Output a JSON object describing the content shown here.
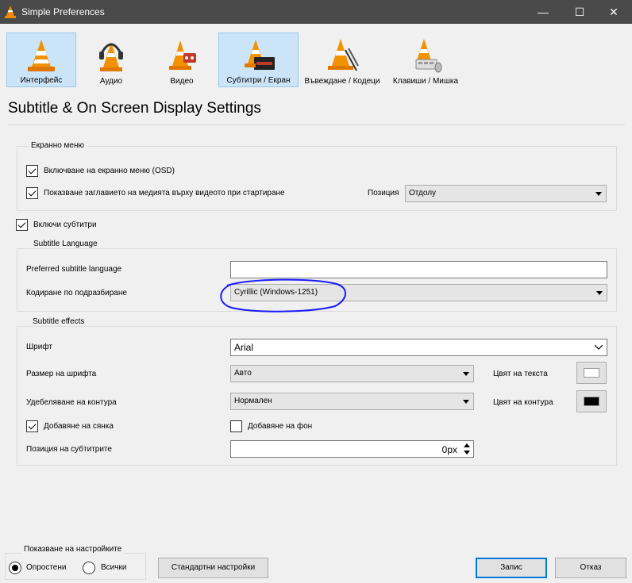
{
  "window": {
    "title": "Simple Preferences",
    "controls": {
      "minimize": "—",
      "maximize": "☐",
      "close": "✕"
    }
  },
  "toolbar": {
    "tabs": [
      {
        "label": "Интерфейс",
        "icon": "interface-cone-icon",
        "active": true
      },
      {
        "label": "Аудио",
        "icon": "headphones-cone-icon",
        "active": false
      },
      {
        "label": "Видео",
        "icon": "video-cone-icon",
        "active": false
      },
      {
        "label": "Субтитри / Екран",
        "icon": "subtitles-cone-icon",
        "active": true
      },
      {
        "label": "Въвеждане / Кодеци",
        "icon": "input-codecs-cone-icon",
        "active": false
      },
      {
        "label": "Клавиши / Мишка",
        "icon": "hotkeys-cone-icon",
        "active": false
      }
    ]
  },
  "page_title": "Subtitle & On Screen Display Settings",
  "osd": {
    "legend": "Екранно меню",
    "enable_osd": {
      "label": "Включване на екранно меню (OSD)",
      "checked": true
    },
    "show_title": {
      "label": "Показване заглавието на медията върху видеото при стартиране",
      "checked": true
    },
    "position_label": "Позиция",
    "position_value": "Отдолу"
  },
  "enable_subtitles": {
    "label": "Включи субтитри",
    "checked": true
  },
  "language": {
    "legend": "Subtitle Language",
    "preferred_label": "Preferred subtitle language",
    "preferred_value": "",
    "encoding_label": "Кодиране по подразбиране",
    "encoding_value": "Cyrillic (Windows-1251)",
    "annotation_color": "#1a1aff"
  },
  "effects": {
    "legend": "Subtitle effects",
    "font_label": "Шрифт",
    "font_value": "Arial",
    "size_label": "Размер на шрифта",
    "size_value": "Авто",
    "text_color_label": "Цвят на текста",
    "text_color": "#ffffff",
    "outline_label": "Удебеляване на контура",
    "outline_value": "Нормален",
    "outline_color_label": "Цвят на контура",
    "outline_color": "#000000",
    "shadow": {
      "label": "Добавяне на сянка",
      "checked": true
    },
    "background": {
      "label": "Добавяне на фон",
      "checked": false
    },
    "position_label": "Позиция на субтитрите",
    "position_value": "0px"
  },
  "footer": {
    "show_settings_legend": "Показване на настройките",
    "simple_label": "Опростени",
    "all_label": "Всички",
    "selected": "simple",
    "reset_label": "Стандартни настройки",
    "save_label": "Запис",
    "cancel_label": "Отказ"
  }
}
